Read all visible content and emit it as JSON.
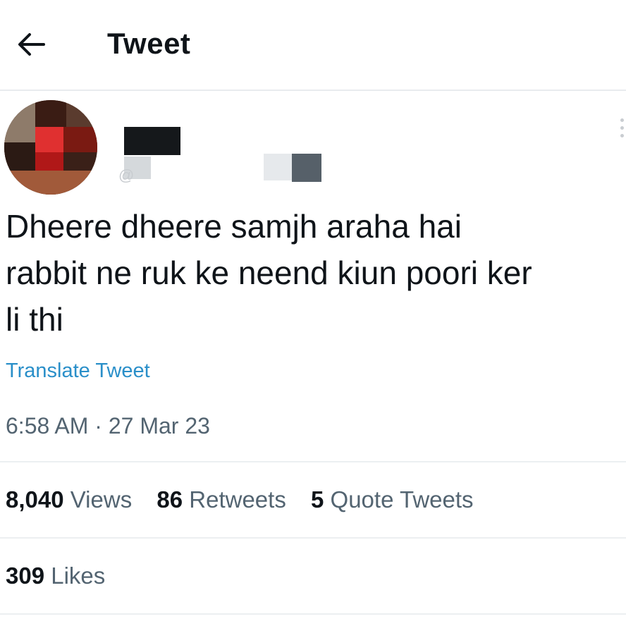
{
  "header": {
    "back_icon": "arrow-left-icon",
    "title": "Tweet"
  },
  "author": {
    "handle_prefix": "@"
  },
  "tweet": {
    "text_lines": [
      "Dheere dheere samjh araha hai",
      "rabbit ne ruk ke neend kiun poori ker",
      "li thi"
    ],
    "translate_label": "Translate Tweet",
    "time": "6:58 AM",
    "separator": "·",
    "date": "27 Mar 23"
  },
  "stats": {
    "views": {
      "count": "8,040",
      "label": "Views"
    },
    "retweets": {
      "count": "86",
      "label": "Retweets"
    },
    "quotes": {
      "count": "5",
      "label": "Quote Tweets"
    },
    "likes": {
      "count": "309",
      "label": "Likes"
    }
  },
  "colors": {
    "link": "#2a8fc9",
    "secondary_text": "#536471",
    "primary_text": "#0f1419",
    "divider": "#eceff1"
  }
}
